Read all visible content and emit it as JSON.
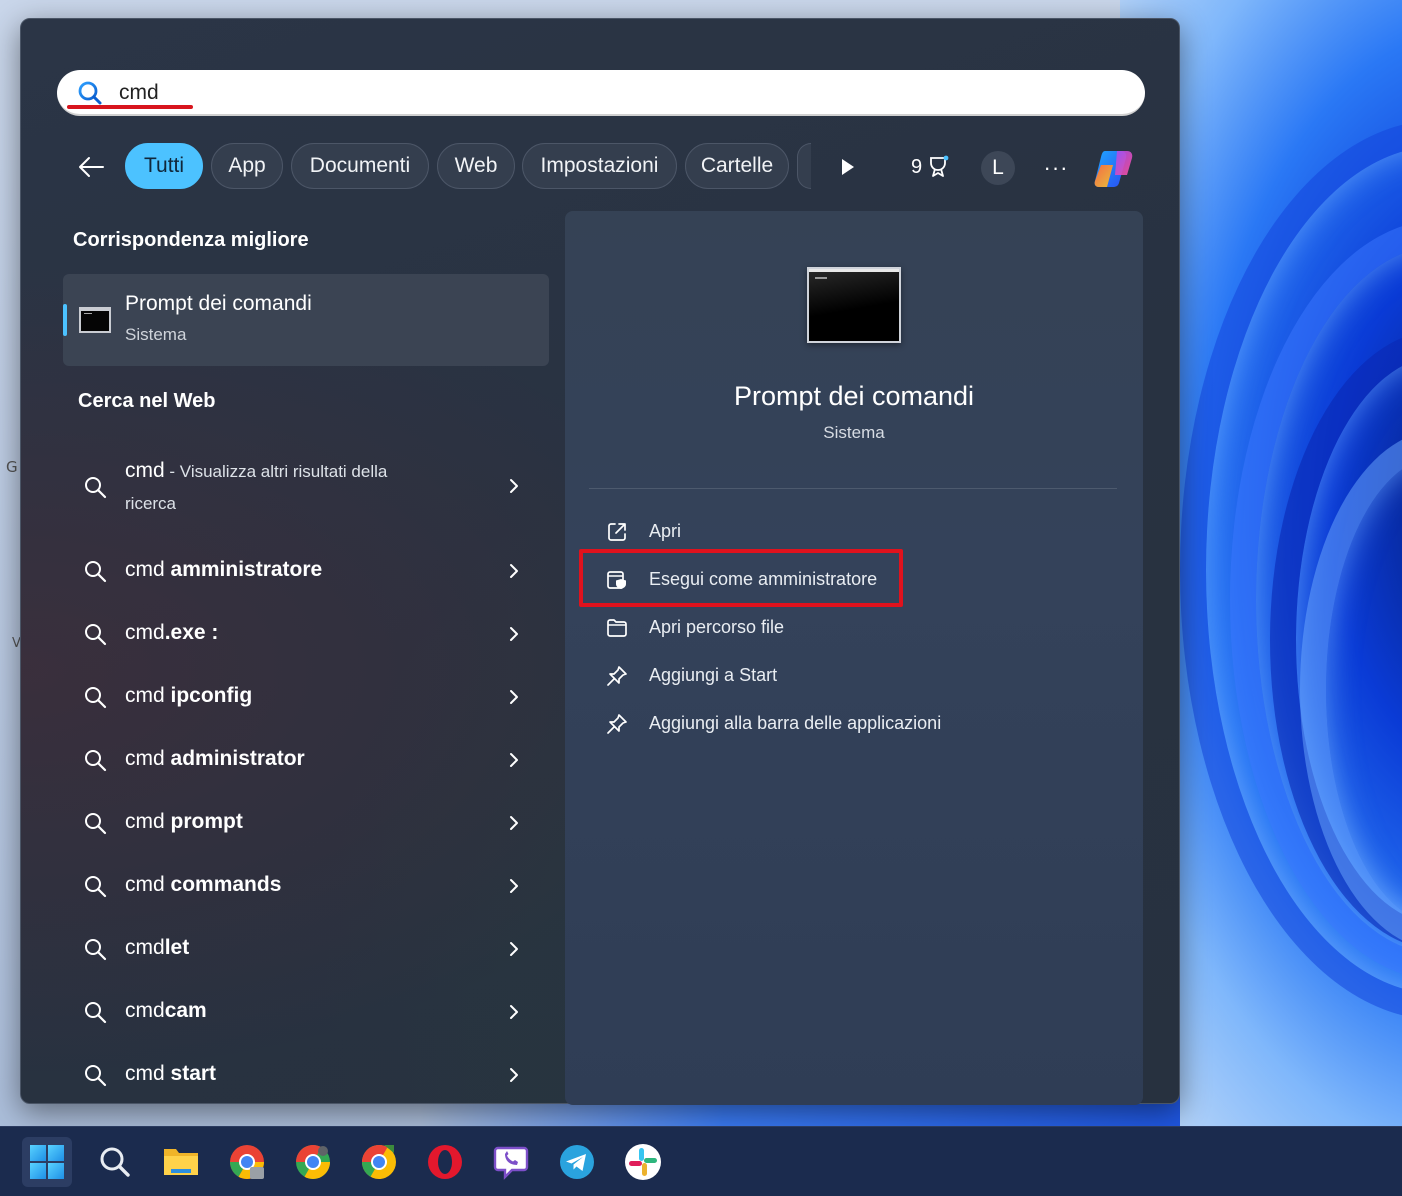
{
  "search": {
    "query": "cmd"
  },
  "filters": {
    "back_label": "Indietro",
    "tabs": [
      {
        "label": "Tutti",
        "active": true
      },
      {
        "label": "App"
      },
      {
        "label": "Documenti"
      },
      {
        "label": "Web"
      },
      {
        "label": "Impostazioni"
      },
      {
        "label": "Cartelle"
      }
    ],
    "points": "9",
    "avatar_initial": "L",
    "more_label": "···"
  },
  "best_match": {
    "heading": "Corrispondenza migliore",
    "title": "Prompt dei comandi",
    "subtitle": "Sistema"
  },
  "web_search": {
    "heading": "Cerca nel Web",
    "items": [
      {
        "prefix": "cmd",
        "bold": "",
        "desc": " - Visualizza altri risultati della",
        "desc2": "ricerca"
      },
      {
        "prefix": "cmd ",
        "bold": "amministratore"
      },
      {
        "prefix": "cmd",
        "bold": ".exe :"
      },
      {
        "prefix": "cmd ",
        "bold": "ipconfig"
      },
      {
        "prefix": "cmd ",
        "bold": "administrator"
      },
      {
        "prefix": "cmd ",
        "bold": "prompt"
      },
      {
        "prefix": "cmd ",
        "bold": "commands"
      },
      {
        "prefix": "cmd",
        "bold": "let"
      },
      {
        "prefix": "cmd",
        "bold": "cam"
      },
      {
        "prefix": "cmd ",
        "bold": "start"
      }
    ]
  },
  "preview": {
    "title": "Prompt dei comandi",
    "subtitle": "Sistema",
    "actions": [
      {
        "label": "Apri",
        "icon": "open-external-icon"
      },
      {
        "label": "Esegui come amministratore",
        "icon": "shield-admin-icon",
        "highlighted": true
      },
      {
        "label": "Apri percorso file",
        "icon": "folder-icon"
      },
      {
        "label": "Aggiungi a Start",
        "icon": "pin-icon"
      },
      {
        "label": "Aggiungi alla barra delle applicazioni",
        "icon": "pin-icon"
      }
    ]
  },
  "taskbar": {
    "apps": [
      "start-icon",
      "search-icon",
      "file-explorer-icon",
      "chrome-icon",
      "chrome-dev-icon",
      "chrome-canary-icon",
      "opera-icon",
      "viber-icon",
      "telegram-icon",
      "slack-icon"
    ]
  },
  "colors": {
    "accent": "#4cc2ff",
    "highlight": "#e0121d",
    "panel": "#2b3546",
    "taskbar": "#1b2b4e"
  },
  "background_text": [
    "G",
    "V"
  ]
}
